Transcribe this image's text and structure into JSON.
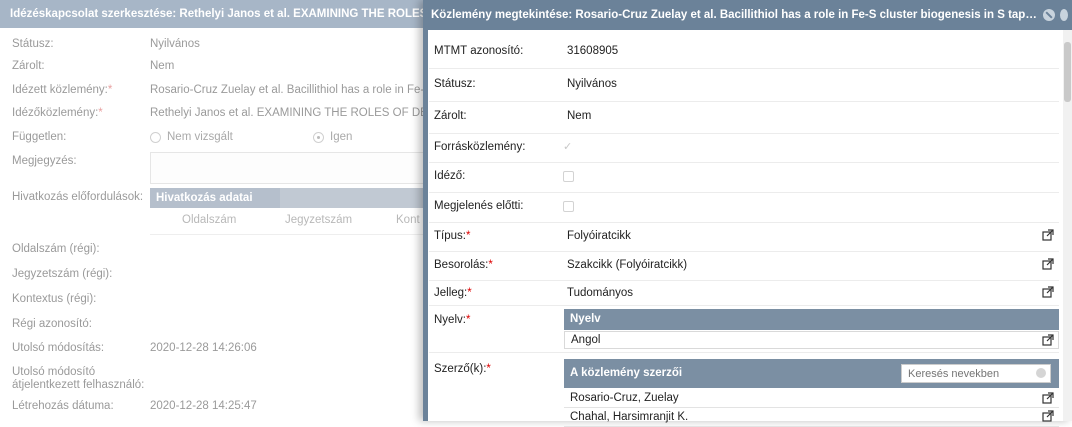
{
  "background_panel": {
    "title": "Idézéskapcsolat szerkesztése: Rethelyi Janos et al. EXAMINING THE ROLES",
    "fields": [
      {
        "label": "Státusz:",
        "value": "Nyilvános"
      },
      {
        "label": "Zárolt:",
        "value": "Nem"
      },
      {
        "label": "Idézett közlemény:",
        "value": "Rosario-Cruz Zuelay et al. Bacillithiol has a role in Fe-"
      },
      {
        "label": "Idézőközlemény:",
        "value": "Rethelyi Janos et al. EXAMINING THE ROLES OF DE"
      },
      {
        "label": "Független:",
        "value": ""
      },
      {
        "label": "Megjegyzés:",
        "value": ""
      },
      {
        "label": "Hivatkozás előfordulások:",
        "value": ""
      },
      {
        "label": "Oldalszám (régi):",
        "value": ""
      },
      {
        "label": "Jegyzetszám (régi):",
        "value": ""
      },
      {
        "label": "Kontextus (régi):",
        "value": ""
      },
      {
        "label": "Régi azonosító:",
        "value": ""
      },
      {
        "label": "Utolsó módosítás:",
        "value": "2020-12-28 14:26:06"
      },
      {
        "label": "Utolsó módosító",
        "value": ""
      },
      {
        "label": "átjelentkezett felhasználó:",
        "value": ""
      },
      {
        "label": "Létrehozás dátuma:",
        "value": "2020-12-28 14:25:47"
      }
    ],
    "independent_options": [
      "Nem vizsgált",
      "Igen"
    ],
    "ref_table": {
      "header": "Hivatkozás adatai",
      "columns": [
        "Oldalszám",
        "Jegyzetszám",
        "Kont"
      ]
    }
  },
  "modal": {
    "title": "Közlemény megtekintése: Rosario-Cruz Zuelay et al. Bacillithiol has a role in Fe-S cluster biogenesis in S taphyl…",
    "fields": [
      {
        "label": "MTMT azonosító:",
        "value": "31608905"
      },
      {
        "label": "Státusz:",
        "value": "Nyilvános"
      },
      {
        "label": "Zárolt:",
        "value": "Nem"
      },
      {
        "label": "Forrásközlemény:",
        "value": ""
      },
      {
        "label": "Idéző:",
        "value": ""
      },
      {
        "label": "Megjelenés előtti:",
        "value": ""
      },
      {
        "label": "Típus:",
        "value": "Folyóiratcikk"
      },
      {
        "label": "Besorolás:",
        "value": "Szakcikk (Folyóiratcikk)"
      },
      {
        "label": "Jelleg:",
        "value": "Tudományos"
      },
      {
        "label": "Nyelv:",
        "value": ""
      },
      {
        "label": "Szerző(k):",
        "value": ""
      }
    ],
    "required_mark": "*",
    "language_table": {
      "header": "Nyelv",
      "value": "Angol"
    },
    "authors_table": {
      "header": "A közlemény szerzői",
      "search_placeholder": "Keresés nevekben",
      "authors": [
        "Rosario-Cruz, Zuelay",
        "Chahal, Harsimranjit K."
      ]
    }
  },
  "icons": {
    "external_link": "external-link-icon",
    "close": "close-icon",
    "clear": "clear-search-icon"
  }
}
